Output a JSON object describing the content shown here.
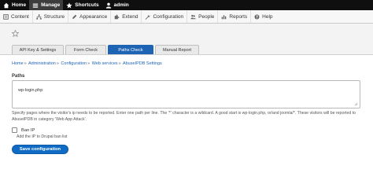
{
  "toolbar": {
    "home": "Home",
    "manage": "Manage",
    "shortcuts": "Shortcuts",
    "user": "admin"
  },
  "admin_menu": {
    "items": [
      {
        "label": "Content",
        "icon": "content-icon"
      },
      {
        "label": "Structure",
        "icon": "structure-icon"
      },
      {
        "label": "Appearance",
        "icon": "appearance-icon"
      },
      {
        "label": "Extend",
        "icon": "extend-icon"
      },
      {
        "label": "Configuration",
        "icon": "configuration-icon"
      },
      {
        "label": "People",
        "icon": "people-icon"
      },
      {
        "label": "Reports",
        "icon": "reports-icon"
      },
      {
        "label": "Help",
        "icon": "help-icon"
      }
    ]
  },
  "tabs": [
    {
      "label": "API Key & Settings",
      "active": false
    },
    {
      "label": "Form Check",
      "active": false
    },
    {
      "label": "Paths Check",
      "active": true
    },
    {
      "label": "Manual Report",
      "active": false
    }
  ],
  "breadcrumb": [
    "Home",
    "Administration",
    "Configuration",
    "Web services",
    "AbuseIPDB Settings"
  ],
  "form": {
    "paths_label": "Paths",
    "paths_value": "wp-login.php",
    "paths_description": "Specify pages where the visitor's ip needs to be reported. Enter one path per line. The '*' character is a wildcard. A good start is wp-login.php, or/and joomla/*. These visitors will be reported to AbuseIPDB in category 'Web App Attack'.",
    "ban_ip_label": "Ban IP",
    "ban_ip_checked": false,
    "ban_ip_description": "Add the IP to Drupal ban list",
    "save_label": "Save configuration"
  },
  "colors": {
    "toolbar_bg": "#0f0f0f",
    "accent": "#1e64b4",
    "link": "#1e63b5"
  }
}
